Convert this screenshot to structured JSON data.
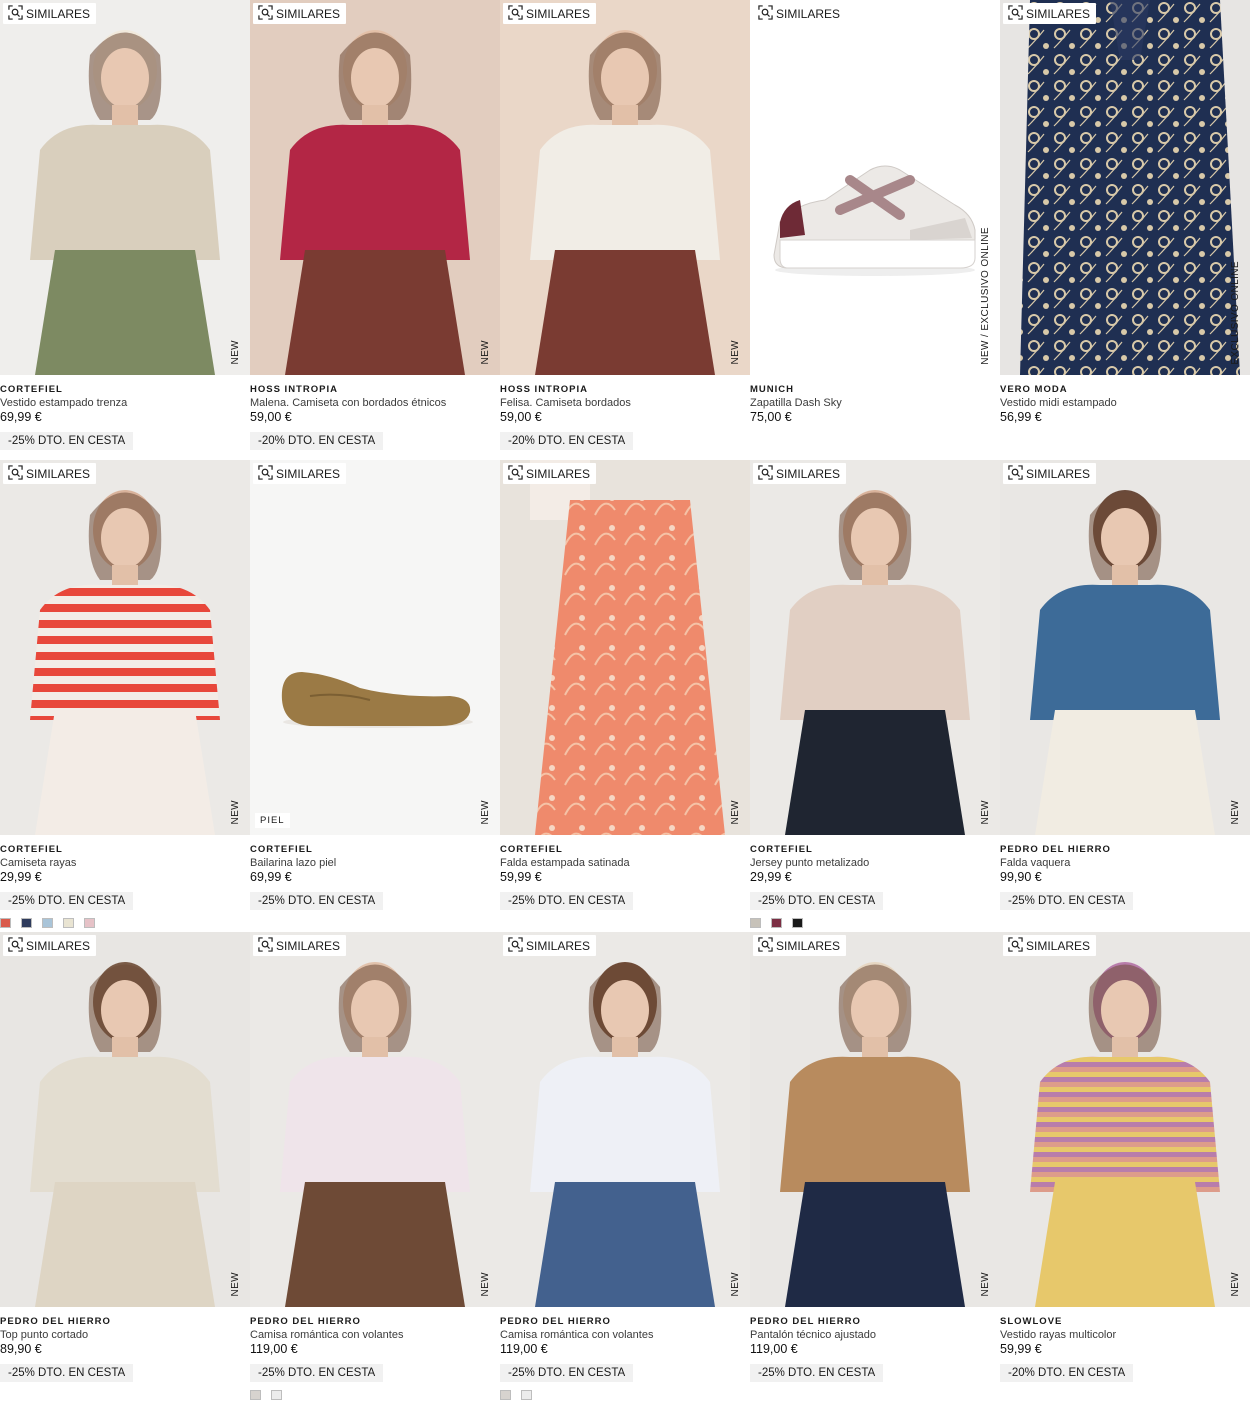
{
  "ui": {
    "similar_label": "SIMILARES"
  },
  "products": [
    {
      "brand": "CORTEFIEL",
      "name": "Vestido estampado trenza",
      "price": "69,99 €",
      "promo": "-25% DTO. EN CESTA",
      "tag": "NEW",
      "bg": "#efeeec",
      "colors": [
        "#d9cfbd",
        "#7d8a62",
        "#f1e9dc"
      ],
      "icon": "woman-seated-printed-dress-photo"
    },
    {
      "brand": "HOSS INTROPIA",
      "name": "Malena. Camiseta con bordados étnicos",
      "price": "59,00 €",
      "promo": "-20% DTO. EN CESTA",
      "tag": "NEW",
      "bg": "#e2cdbf",
      "colors": [
        "#b32645",
        "#7a3b32",
        "#e3c0a8"
      ],
      "icon": "woman-red-embroidered-tshirt-photo"
    },
    {
      "brand": "HOSS INTROPIA",
      "name": "Felisa. Camiseta bordados",
      "price": "59,00 €",
      "promo": "-20% DTO. EN CESTA",
      "tag": "NEW",
      "bg": "#ead7c8",
      "colors": [
        "#f1ede6",
        "#7a3b32",
        "#e3c0a8"
      ],
      "icon": "woman-white-embroidered-tshirt-photo"
    },
    {
      "brand": "MUNICH",
      "name": "Zapatilla Dash Sky",
      "price": "75,00 €",
      "promo": "",
      "tag": "NEW / EXCLUSIVO ONLINE",
      "bg": "#ffffff",
      "colors": [
        "#ece9e6",
        "#a8878a",
        "#6e2a36"
      ],
      "icon": "white-sneaker-photo"
    },
    {
      "brand": "VERO MODA",
      "name": "Vestido midi estampado",
      "price": "56,99 €",
      "promo": "",
      "tag": "EXCLUSIVO ONLINE",
      "bg": "#e7e5e3",
      "colors": [
        "#1f2f52",
        "#d8c9a9",
        "#2b3b63"
      ],
      "icon": "navy-paisley-dress-photo"
    },
    {
      "brand": "CORTEFIEL",
      "name": "Camiseta rayas",
      "price": "29,99 €",
      "promo": "-25% DTO. EN CESTA",
      "tag": "NEW",
      "bg": "#ebe9e6",
      "colors": [
        "#e8473a",
        "#f3ece6",
        "#d9b39c"
      ],
      "icon": "woman-striped-tshirt-photo",
      "swatches": [
        "#d95b4c",
        "#2e3b5c",
        "#a9c4d8",
        "#e9e4d2",
        "#e6c2c7"
      ]
    },
    {
      "brand": "CORTEFIEL",
      "name": "Bailarina lazo piel",
      "price": "69,99 €",
      "promo": "-25% DTO. EN CESTA",
      "tag": "NEW",
      "piel": "PIEL",
      "bg": "#f6f6f5",
      "colors": [
        "#9b7a45",
        "#ffffff",
        "#ffffff"
      ],
      "icon": "suede-ballet-flat-photo"
    },
    {
      "brand": "CORTEFIEL",
      "name": "Falda estampada satinada",
      "price": "59,99 €",
      "promo": "-25% DTO. EN CESTA",
      "tag": "NEW",
      "bg": "#e8e3dc",
      "colors": [
        "#ef8a6c",
        "#f3ece6",
        "#e3bd9b"
      ],
      "icon": "coral-paisley-skirt-photo"
    },
    {
      "brand": "CORTEFIEL",
      "name": "Jersey punto metalizado",
      "price": "29,99 €",
      "promo": "-25% DTO. EN CESTA",
      "tag": "NEW",
      "bg": "#ebe9e6",
      "colors": [
        "#e1cfc3",
        "#1f2531",
        "#d9b39c"
      ],
      "icon": "woman-beige-knit-jersey-photo",
      "swatches": [
        "#c7c2b9",
        "#7b2e43",
        "#1a1a1a"
      ]
    },
    {
      "brand": "PEDRO DEL HIERRO",
      "name": "Falda vaquera",
      "price": "99,90 €",
      "promo": "-25% DTO. EN CESTA",
      "tag": "NEW",
      "bg": "#e9e7e4",
      "colors": [
        "#3d6b98",
        "#f1ece2",
        "#6a4a3a"
      ],
      "icon": "woman-denim-skirt-photo"
    },
    {
      "brand": "PEDRO DEL HIERRO",
      "name": "Top punto cortado",
      "price": "89,90 €",
      "promo": "-25% DTO. EN CESTA",
      "tag": "NEW",
      "bg": "#e8e6e3",
      "colors": [
        "#e3ddd0",
        "#ded5c4",
        "#7a5b47"
      ],
      "icon": "woman-knit-top-cream-skirt-photo"
    },
    {
      "brand": "PEDRO DEL HIERRO",
      "name": "Camisa romántica con volantes",
      "price": "119,00 €",
      "promo": "-25% DTO. EN CESTA",
      "tag": "NEW",
      "bg": "#ebe9e6",
      "colors": [
        "#efe4ea",
        "#6e4a36",
        "#e1c2ac"
      ],
      "icon": "woman-ruffle-blouse-pink-photo",
      "swatches": [
        "#d7d3cf",
        "#ececec"
      ]
    },
    {
      "brand": "PEDRO DEL HIERRO",
      "name": "Camisa romántica con volantes",
      "price": "119,00 €",
      "promo": "-25% DTO. EN CESTA",
      "tag": "NEW",
      "bg": "#ebe9e6",
      "colors": [
        "#eef0f6",
        "#43618e",
        "#6e4a36"
      ],
      "icon": "woman-ruffle-blouse-white-photo",
      "swatches": [
        "#d7d3cf",
        "#ececec"
      ]
    },
    {
      "brand": "PEDRO DEL HIERRO",
      "name": "Pantalón técnico ajustado",
      "price": "119,00 €",
      "promo": "-25% DTO. EN CESTA",
      "tag": "NEW",
      "bg": "#e9e7e4",
      "colors": [
        "#b88b5e",
        "#1f2a45",
        "#e6d6c2"
      ],
      "icon": "woman-navy-trousers-jacket-photo"
    },
    {
      "brand": "SLOWLOVE",
      "name": "Vestido rayas multicolor",
      "price": "59,99 €",
      "promo": "-20% DTO. EN CESTA",
      "tag": "NEW",
      "bg": "#e9e7e4",
      "colors": [
        "#dd9c8a",
        "#e7c86b",
        "#b87dab"
      ],
      "icon": "woman-multicolor-striped-dress-photo"
    }
  ]
}
